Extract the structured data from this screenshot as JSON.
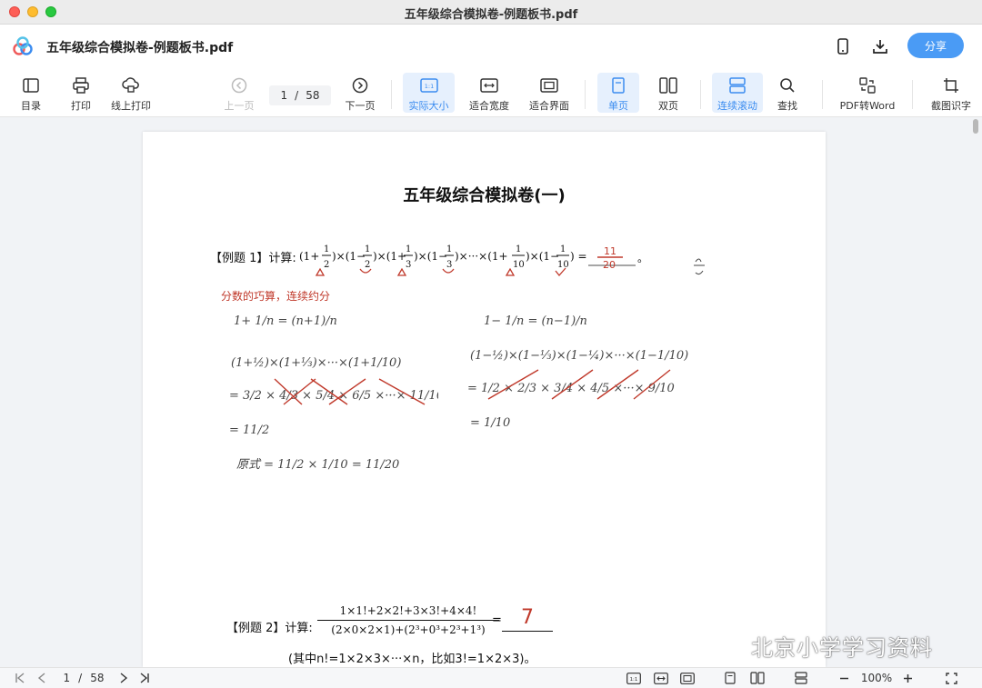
{
  "window": {
    "title": "五年级综合模拟卷-例题板书.pdf"
  },
  "header": {
    "doc_title": "五年级综合模拟卷-例题板书.pdf",
    "share_label": "分享"
  },
  "toolbar": {
    "contents": "目录",
    "print": "打印",
    "online_print": "线上打印",
    "prev_page": "上一页",
    "page_current": "1",
    "page_sep": "/",
    "page_total": "58",
    "next_page": "下一页",
    "actual_size": "实际大小",
    "fit_width": "适合宽度",
    "fit_window": "适合界面",
    "single_page": "单页",
    "double_page": "双页",
    "continuous_scroll": "连续滚动",
    "find": "查找",
    "pdf_to_word": "PDF转Word",
    "screenshot_ocr": "截图识字"
  },
  "document": {
    "heading": "五年级综合模拟卷(一)",
    "example1_label": "【例题 1】计算:",
    "example1_answer": "11/20",
    "handnote": "分数的巧算，连续约分",
    "example2_label": "【例题 2】计算:",
    "example2_numerator": "1×1!+2×2!+3×3!+4×4!",
    "example2_denominator": "(2×0×2×1)+(2³+0³+2³+1³)",
    "example2_answer": "7",
    "example2_note": "(其中n!=1×2×3×···×n，比如3!=1×2×3)。"
  },
  "watermark": {
    "text": "北京小学学习资料"
  },
  "status": {
    "page_current": "1",
    "page_sep": "/",
    "page_total": "58",
    "zoom": "100%"
  },
  "colors": {
    "accent": "#4a9bf5",
    "active_bg": "#e6f0fd",
    "ink_red": "#c0392b"
  }
}
